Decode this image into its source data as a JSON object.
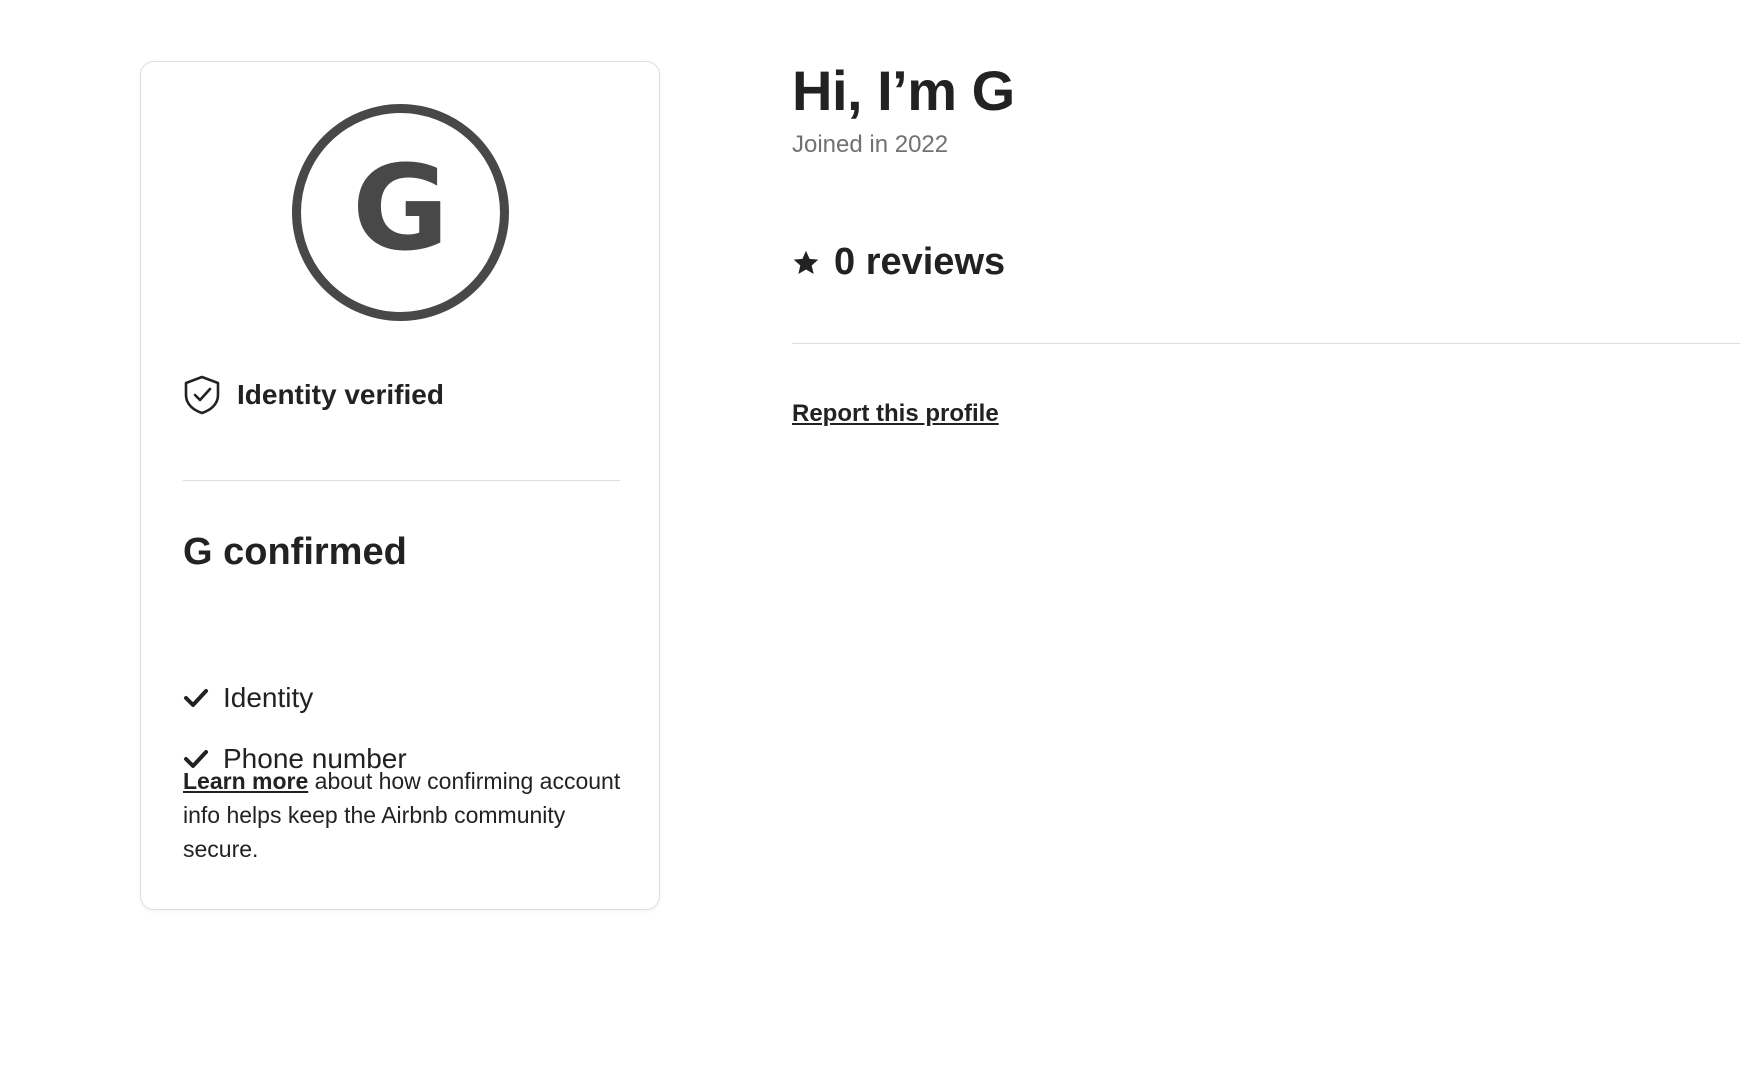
{
  "profile_card": {
    "avatar_initial": "G",
    "verified_label": "Identity verified",
    "confirmed_title": "G confirmed",
    "confirmed_items": [
      {
        "label": "Identity",
        "icon": "check-icon"
      },
      {
        "label": "Phone number",
        "icon": "check-icon"
      }
    ],
    "learn_more_link": "Learn more",
    "learn_more_text": " about how confirming account info helps keep the Airbnb community secure."
  },
  "main": {
    "greeting": "Hi, I’m G",
    "joined": "Joined in 2022",
    "reviews_label": "0 reviews",
    "reviews_icon": "star-icon",
    "report_link": "Report this profile"
  },
  "colors": {
    "text": "#222222",
    "muted": "#717171",
    "avatar": "#484848",
    "border": "#dddddd"
  }
}
